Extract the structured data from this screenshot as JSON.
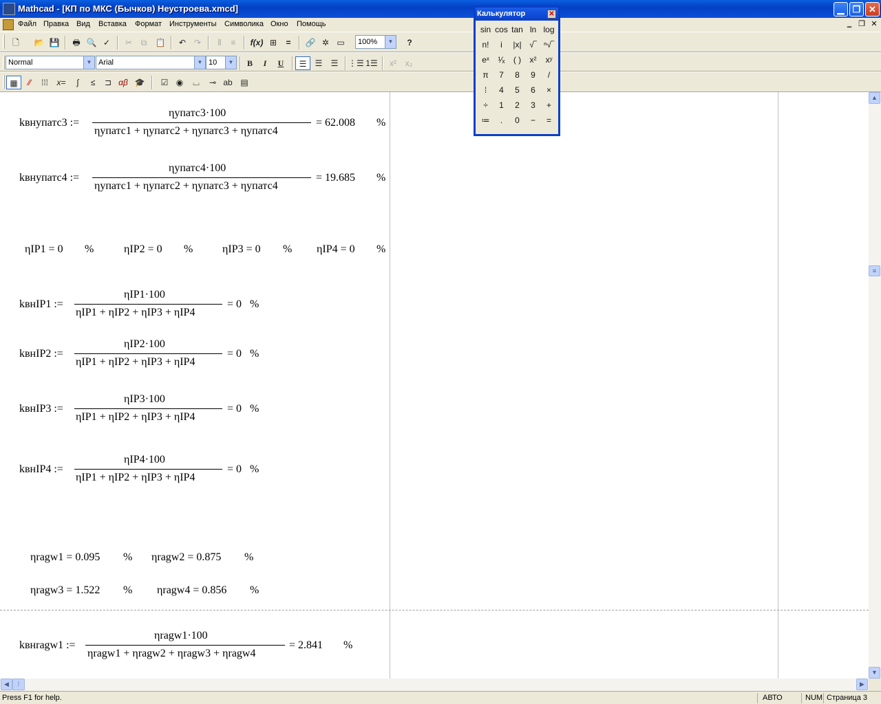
{
  "window": {
    "title": "Mathcad - [КП по МКС (Бычков) Неустроева.xmcd]",
    "min_glyph": "▁",
    "max_glyph": "❐",
    "close_glyph": "✕"
  },
  "menu": [
    "Файл",
    "Правка",
    "Вид",
    "Вставка",
    "Формат",
    "Инструменты",
    "Символика",
    "Окно",
    "Помощь"
  ],
  "mdi_controls": [
    "‗",
    "❐",
    "✕"
  ],
  "toolbar_standard": {
    "zoom": "100%",
    "buttons": [
      "new-icon",
      "open-icon",
      "save-icon",
      "print-icon",
      "print-preview-icon",
      "spell-check-icon",
      "cut-icon",
      "copy-icon",
      "paste-icon",
      "undo-icon",
      "redo-icon",
      "align-horizontal-icon",
      "align-vertical-icon",
      "insert-function-icon",
      "insert-unit-icon",
      "calculate-icon",
      "insert-hyperlink-icon",
      "component-wizard-icon",
      "resources-icon",
      "help-icon"
    ]
  },
  "toolbar_format": {
    "style": "Normal",
    "font": "Arial",
    "size": "10",
    "bold": "B",
    "italic": "I",
    "underline": "U",
    "superscript": "x²",
    "subscript": "x₂"
  },
  "toolbar_math": [
    "calculator-icon",
    "graph-icon",
    "matrix-icon",
    "evaluation-icon",
    "calculus-icon",
    "boolean-icon",
    "programming-icon",
    "greek-icon",
    "symbolic-icon"
  ],
  "worksheet": {
    "k3": {
      "lhs": "kвнупатс3 :=",
      "num": "ηупатс3·100",
      "den": "ηупатс1 + ηупатс2 + ηупатс3 + ηупатс4",
      "result": "= 62.008",
      "unit": "%"
    },
    "k4": {
      "lhs": "kвнупатс4 :=",
      "num": "ηупатс4·100",
      "den": "ηупатс1 + ηупатс2 + ηупатс3 + ηупатс4",
      "result": "= 19.685",
      "unit": "%"
    },
    "ip_values": [
      {
        "expr": "ηIP1 = 0",
        "unit": "%"
      },
      {
        "expr": "ηIP2 = 0",
        "unit": "%"
      },
      {
        "expr": "ηIP3 = 0",
        "unit": "%"
      },
      {
        "expr": "ηIP4 = 0",
        "unit": "%"
      }
    ],
    "kip": [
      {
        "lhs": "kвнIP1 :=",
        "num": "ηIP1·100",
        "den": "ηIP1 + ηIP2 + ηIP3 + ηIP4",
        "result": "= 0",
        "unit": "%"
      },
      {
        "lhs": "kвнIP2 :=",
        "num": "ηIP2·100",
        "den": "ηIP1 + ηIP2 + ηIP3 + ηIP4",
        "result": "= 0",
        "unit": "%"
      },
      {
        "lhs": "kвнIP3 :=",
        "num": "ηIP3·100",
        "den": "ηIP1 + ηIP2 + ηIP3 + ηIP4",
        "result": "= 0",
        "unit": "%"
      },
      {
        "lhs": "kвнIP4 :=",
        "num": "ηIP4·100",
        "den": "ηIP1 + ηIP2 + ηIP3 + ηIP4",
        "result": "= 0",
        "unit": "%"
      }
    ],
    "ragw_values": [
      {
        "expr": "ηragw1 = 0.095",
        "unit": "%"
      },
      {
        "expr": "ηragw2 = 0.875",
        "unit": "%"
      },
      {
        "expr": "ηragw3 = 1.522",
        "unit": "%"
      },
      {
        "expr": "ηragw4 = 0.856",
        "unit": "%"
      }
    ],
    "kragw1": {
      "lhs": "kвнragw1 :=",
      "num": "ηragw1·100",
      "den": "ηragw1 + ηragw2 + ηragw3 + ηragw4",
      "result": "= 2.841",
      "unit": "%"
    }
  },
  "calculator": {
    "title": "Калькулятор",
    "close": "✕",
    "rows": [
      [
        "sin",
        "cos",
        "tan",
        "ln",
        "log"
      ],
      [
        "n!",
        "i",
        "|x|",
        "√‾",
        "ⁿ√‾"
      ],
      [
        "eˣ",
        "¹⁄ₓ",
        "( )",
        "x²",
        "xʸ"
      ],
      [
        "π",
        "7",
        "8",
        "9",
        "/"
      ],
      [
        "⁞",
        "4",
        "5",
        "6",
        "×"
      ],
      [
        "÷",
        "1",
        "2",
        "3",
        "+"
      ],
      [
        "≔",
        ".",
        "0",
        "−",
        "="
      ]
    ]
  },
  "scroll": {
    "up": "▲",
    "down": "▼",
    "left": "◀",
    "right": "▶"
  },
  "status": {
    "help": "Press F1 for help.",
    "mode": "АВТО",
    "num": "NUM",
    "page": "Страница 3"
  }
}
